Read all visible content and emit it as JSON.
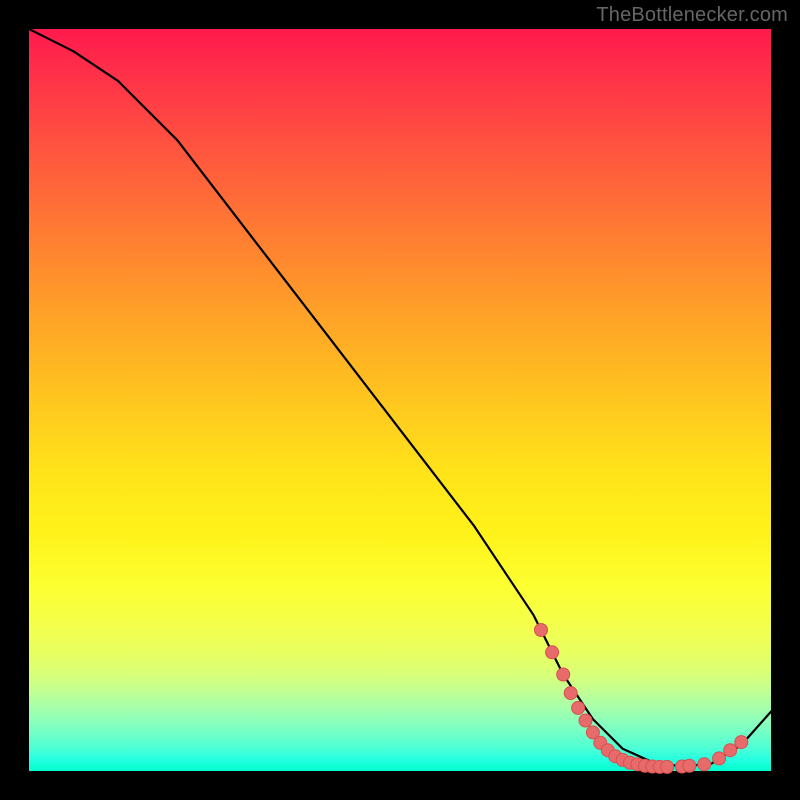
{
  "watermark": "TheBottlenecker.com",
  "chart_data": {
    "type": "line",
    "title": "",
    "xlabel": "",
    "ylabel": "",
    "xlim": [
      0,
      100
    ],
    "ylim": [
      0,
      100
    ],
    "series": [
      {
        "name": "curve",
        "x": [
          0,
          6,
          12,
          20,
          30,
          40,
          50,
          60,
          68,
          72,
          76,
          80,
          84,
          88,
          92,
          96,
          100
        ],
        "y": [
          100,
          97,
          93,
          85,
          72,
          59,
          46,
          33,
          21,
          13,
          7,
          3,
          1.2,
          0.6,
          1.0,
          3.5,
          8
        ]
      }
    ],
    "markers": [
      {
        "x": 69.0,
        "y": 19.0
      },
      {
        "x": 70.5,
        "y": 16.0
      },
      {
        "x": 72.0,
        "y": 13.0
      },
      {
        "x": 73.0,
        "y": 10.5
      },
      {
        "x": 74.0,
        "y": 8.5
      },
      {
        "x": 75.0,
        "y": 6.8
      },
      {
        "x": 76.0,
        "y": 5.2
      },
      {
        "x": 77.0,
        "y": 3.8
      },
      {
        "x": 78.0,
        "y": 2.8
      },
      {
        "x": 79.0,
        "y": 2.0
      },
      {
        "x": 80.0,
        "y": 1.5
      },
      {
        "x": 81.0,
        "y": 1.1
      },
      {
        "x": 82.0,
        "y": 0.9
      },
      {
        "x": 83.0,
        "y": 0.7
      },
      {
        "x": 84.0,
        "y": 0.6
      },
      {
        "x": 85.0,
        "y": 0.55
      },
      {
        "x": 86.0,
        "y": 0.55
      },
      {
        "x": 88.0,
        "y": 0.6
      },
      {
        "x": 89.0,
        "y": 0.7
      },
      {
        "x": 91.0,
        "y": 0.9
      },
      {
        "x": 93.0,
        "y": 1.7
      },
      {
        "x": 94.5,
        "y": 2.8
      },
      {
        "x": 96.0,
        "y": 3.9
      }
    ],
    "colors": {
      "curve": "#000000",
      "marker_fill": "#e86b6b",
      "marker_stroke": "#d94f4f"
    }
  }
}
